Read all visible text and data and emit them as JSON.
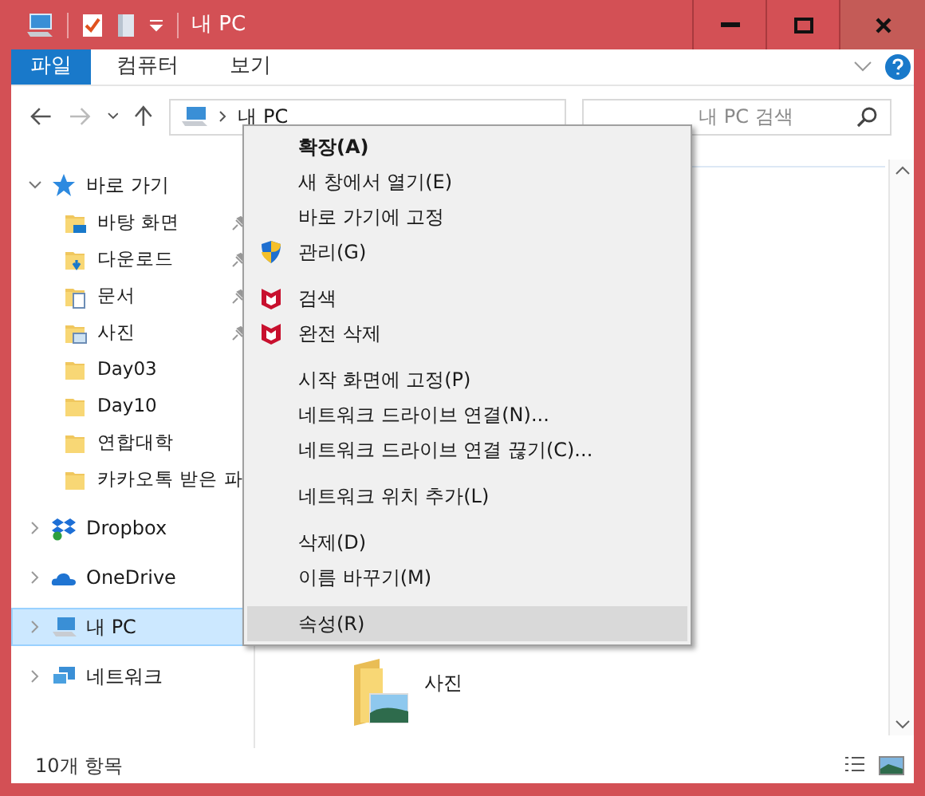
{
  "window": {
    "title": "내 PC"
  },
  "ribbon_tabs": [
    {
      "label": "파일",
      "selected": true
    },
    {
      "label": "컴퓨터",
      "selected": false
    },
    {
      "label": "보기",
      "selected": false
    }
  ],
  "address_bar": {
    "path": "내 PC"
  },
  "search": {
    "placeholder": "내 PC 검색"
  },
  "sidebar": {
    "items": [
      {
        "label": "바로 가기",
        "kind": "quick",
        "expanded": true,
        "selected": false,
        "children": [
          {
            "label": "바탕 화면",
            "kind": "desktop",
            "pinned": true
          },
          {
            "label": "다운로드",
            "kind": "downloads",
            "pinned": true
          },
          {
            "label": "문서",
            "kind": "documents",
            "pinned": true
          },
          {
            "label": "사진",
            "kind": "pictures",
            "pinned": true
          },
          {
            "label": "Day03",
            "kind": "folder",
            "pinned": false
          },
          {
            "label": "Day10",
            "kind": "folder",
            "pinned": false
          },
          {
            "label": "연합대학",
            "kind": "folder",
            "pinned": false
          },
          {
            "label": "카카오톡 받은 파",
            "kind": "folder",
            "pinned": false
          }
        ]
      },
      {
        "label": "Dropbox",
        "kind": "dropbox",
        "expanded": false,
        "selected": false
      },
      {
        "label": "OneDrive",
        "kind": "onedrive",
        "expanded": false,
        "selected": false
      },
      {
        "label": "내 PC",
        "kind": "pc",
        "expanded": false,
        "selected": true
      },
      {
        "label": "네트워크",
        "kind": "network",
        "expanded": false,
        "selected": false
      }
    ]
  },
  "content": {
    "items": [
      {
        "label": "사진",
        "kind": "pictures"
      }
    ]
  },
  "status_bar": {
    "count": "10개 항목"
  },
  "context_menu": {
    "groups": [
      [
        {
          "label": "확장(A)",
          "kind": "default",
          "highlighted": false
        },
        {
          "label": "새 창에서 열기(E)",
          "kind": "plain",
          "highlighted": false
        },
        {
          "label": "바로 가기에 고정",
          "kind": "plain",
          "highlighted": false
        },
        {
          "label": "관리(G)",
          "kind": "admin",
          "highlighted": false
        }
      ],
      [
        {
          "label": "검색",
          "kind": "mcafee",
          "highlighted": false
        },
        {
          "label": "완전 삭제",
          "kind": "mcafee",
          "highlighted": false
        }
      ],
      [
        {
          "label": "시작 화면에 고정(P)",
          "kind": "plain",
          "highlighted": false
        },
        {
          "label": "네트워크 드라이브 연결(N)...",
          "kind": "plain",
          "highlighted": false
        },
        {
          "label": "네트워크 드라이브 연결 끊기(C)...",
          "kind": "plain",
          "highlighted": false
        }
      ],
      [
        {
          "label": "네트워크 위치 추가(L)",
          "kind": "plain",
          "highlighted": false
        }
      ],
      [
        {
          "label": "삭제(D)",
          "kind": "plain",
          "highlighted": false
        },
        {
          "label": "이름 바꾸기(M)",
          "kind": "plain",
          "highlighted": false
        }
      ],
      [
        {
          "label": "속성(R)",
          "kind": "plain",
          "highlighted": true
        }
      ]
    ]
  }
}
